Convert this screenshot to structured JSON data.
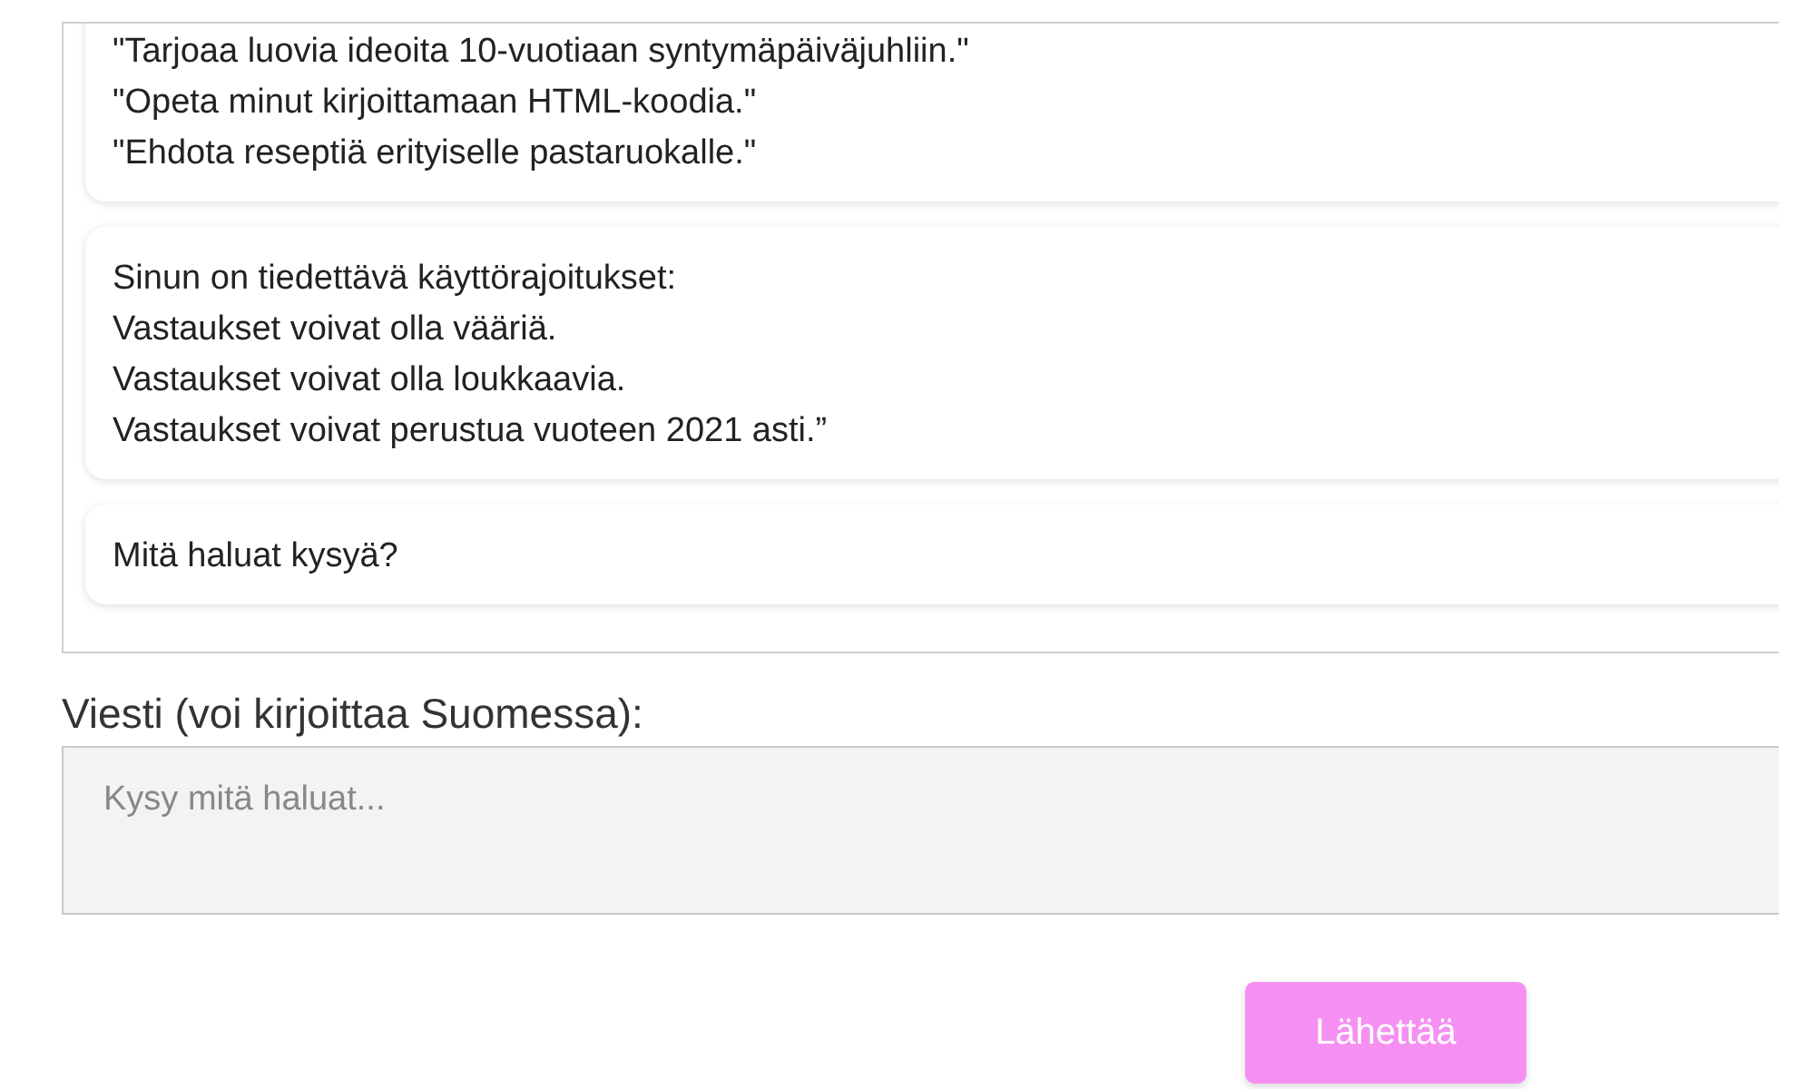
{
  "chat": {
    "messages": [
      {
        "text": "\"Tarjoaa luovia ideoita 10-vuotiaan syntymäpäiväjuhliin.\"\n\"Opeta minut kirjoittamaan HTML-koodia.\"\n\"Ehdota reseptiä erityiselle pastaruokalle.\""
      },
      {
        "text": "Sinun on tiedettävä käyttörajoitukset:\nVastaukset voivat olla vääriä.\nVastaukset voivat olla loukkaavia.\nVastaukset voivat perustua vuoteen 2021 asti.”"
      },
      {
        "text": "Mitä haluat kysyä?"
      }
    ]
  },
  "message_field": {
    "label": "Viesti (voi kirjoittaa Suomessa):",
    "placeholder": "Kysy mitä haluat..."
  },
  "send_button": {
    "label": "Lähettää"
  }
}
